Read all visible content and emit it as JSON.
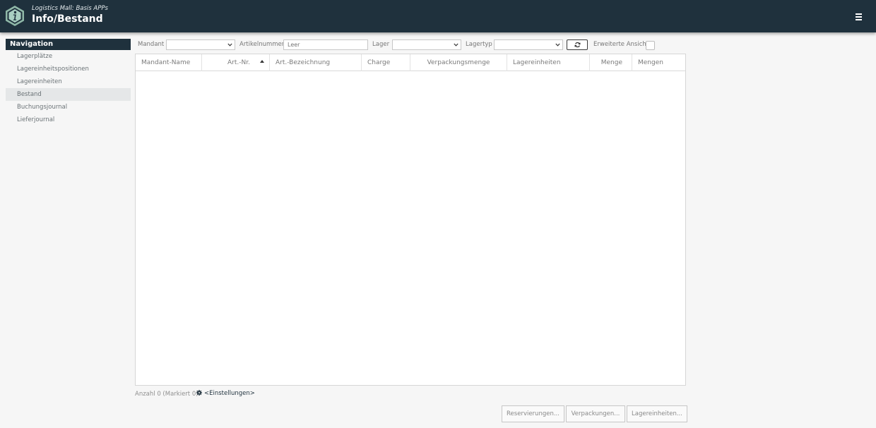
{
  "header": {
    "subtitle": "Logistics Mall: Basis APPs",
    "title": "Info/Bestand",
    "brand_color": "#1f313d",
    "logo_icon": "info-hexagon-icon",
    "menu_icon": "hamburger-icon"
  },
  "nav": {
    "title": "Navigation",
    "items": [
      {
        "label": "Lagerplätze",
        "active": false
      },
      {
        "label": "Lagereinheitspositionen",
        "active": false
      },
      {
        "label": "Lagereinheiten",
        "active": false
      },
      {
        "label": "Bestand",
        "active": true
      },
      {
        "label": "Buchungsjournal",
        "active": false
      },
      {
        "label": "Lieferjournal",
        "active": false
      }
    ]
  },
  "filters": {
    "mandant_label": "Mandant",
    "mandant_value": "",
    "artikelnummer_label": "Artikelnummer",
    "artikelnummer_value": "Leer",
    "lager_label": "Lager",
    "lager_value": "",
    "lagertyp_label": "Lagertyp",
    "lagertyp_value": "",
    "refresh_icon": "refresh-icon",
    "extended_view_label": "Erweiterte Ansicht",
    "extended_view_checked": false
  },
  "table": {
    "columns": [
      {
        "label": "Mandant-Name"
      },
      {
        "label": "Art.-Nr.",
        "sorted": "ascending"
      },
      {
        "label": "Art.-Bezeichnung"
      },
      {
        "label": "Charge"
      },
      {
        "label": "Verpackungsmenge"
      },
      {
        "label": "Lagereinheiten"
      },
      {
        "label": "Menge"
      },
      {
        "label": "Mengen"
      }
    ],
    "rows": []
  },
  "footer": {
    "count_text": "Anzahl 0 (Markiert 0)",
    "settings_label": "<Einstellungen>",
    "settings_icon": "gear-icon"
  },
  "actions": {
    "reservations_label": "Reservierungen...",
    "packaging_label": "Verpackungen...",
    "storage_units_label": "Lagereinheiten..."
  }
}
